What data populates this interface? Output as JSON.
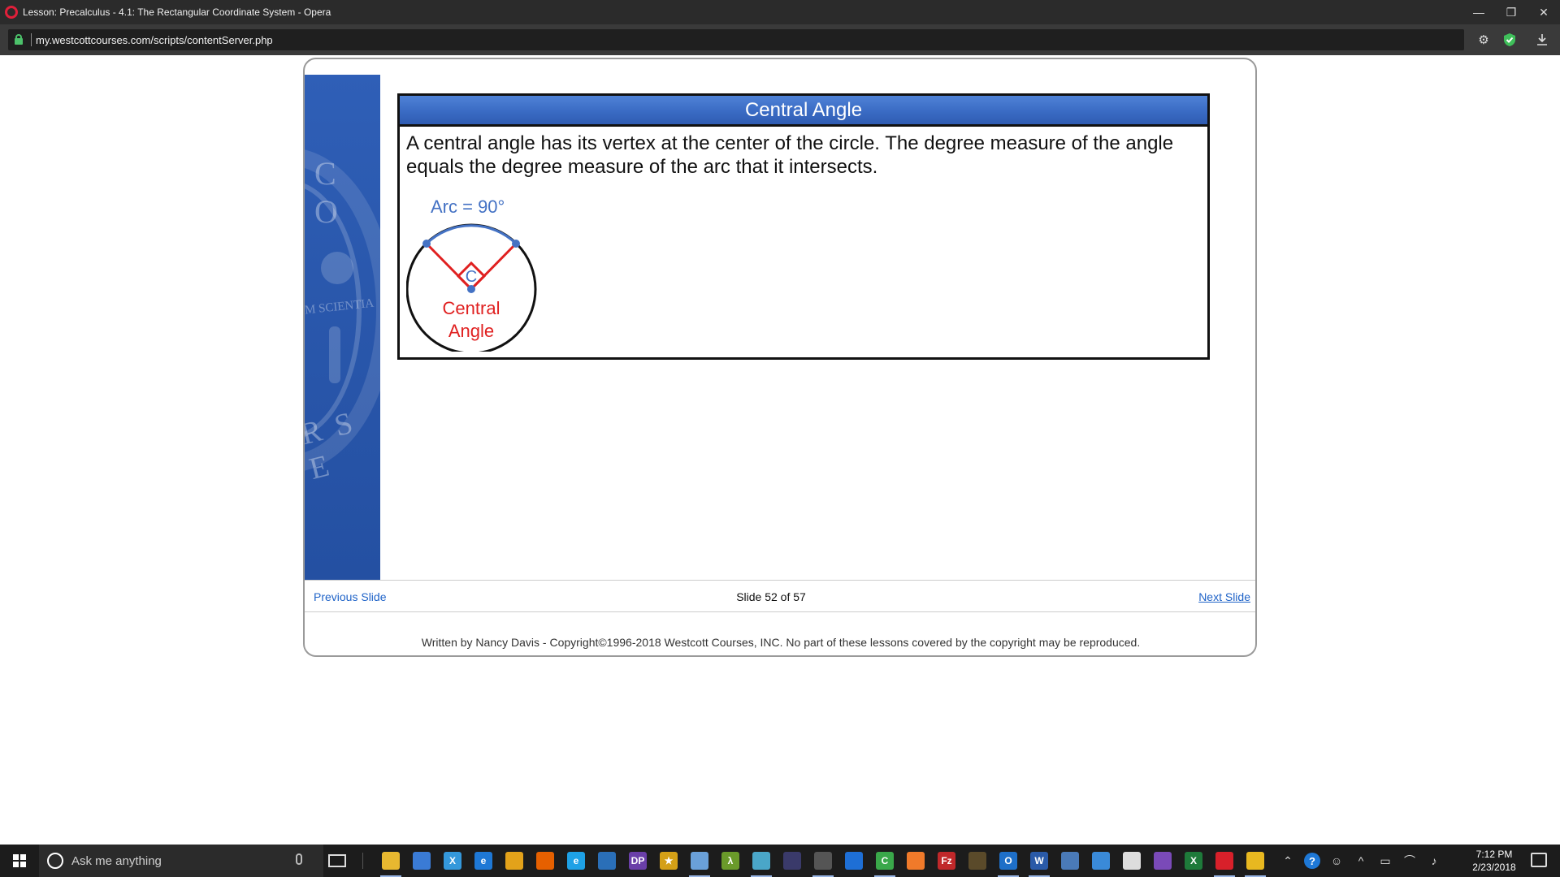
{
  "window": {
    "title": "Lesson: Precalculus - 4.1: The Rectangular Coordinate System - Opera",
    "minimize_icon": "minimize-icon",
    "restore_icon": "restore-icon",
    "close_icon": "close-icon"
  },
  "address_bar": {
    "url": "my.westcottcourses.com/scripts/contentServer.php",
    "icons": [
      "lock-icon",
      "gear-icon",
      "shield-icon",
      "download-icon"
    ]
  },
  "slide": {
    "title": "Central Angle",
    "body": "A central angle has its vertex at the center of the circle.  The degree measure of the angle equals the degree measure of the arc that it intersects.",
    "figure": {
      "arc_label": "Arc = 90°",
      "center_label": "C",
      "angle_label_line1": "Central",
      "angle_label_line2": "Angle",
      "colors": {
        "arc": "#4472c4",
        "angle": "#e02020",
        "circle": "#111111"
      }
    },
    "seal_text": {
      "top": "C O",
      "middle": "M SCIENTIA",
      "bottom": "R S E"
    }
  },
  "nav": {
    "prev_label": "Previous Slide",
    "counter": "Slide 52 of 57",
    "next_label": "Next Slide"
  },
  "footer": {
    "copyright": "Written by Nancy Davis - Copyright©1996-2018 Westcott Courses, INC. No part of these lessons covered by the copyright may be reproduced."
  },
  "taskbar": {
    "search_placeholder": "Ask me anything",
    "time": "7:12 PM",
    "date": "2/23/2018",
    "apps": [
      {
        "name": "file-explorer-icon",
        "color": "#e8b830",
        "glyph": ""
      },
      {
        "name": "store-icon",
        "color": "#3a7bd5",
        "glyph": ""
      },
      {
        "name": "xamarin-icon",
        "color": "#3498db",
        "glyph": "X"
      },
      {
        "name": "edge-icon",
        "color": "#1e78d6",
        "glyph": "e"
      },
      {
        "name": "chrome-icon",
        "color": "#e3a21a",
        "glyph": ""
      },
      {
        "name": "firefox-icon",
        "color": "#e66000",
        "glyph": ""
      },
      {
        "name": "ie-icon",
        "color": "#1ea1e6",
        "glyph": "e"
      },
      {
        "name": "powershell-icon",
        "color": "#2a6fb8",
        "glyph": ""
      },
      {
        "name": "dp-icon",
        "color": "#6a3fa8",
        "glyph": "DP"
      },
      {
        "name": "star-app-icon",
        "color": "#d4a017",
        "glyph": "★"
      },
      {
        "name": "paint-icon",
        "color": "#6aa0d8",
        "glyph": ""
      },
      {
        "name": "lambda-icon",
        "color": "#6a9a2a",
        "glyph": "λ"
      },
      {
        "name": "book-icon",
        "color": "#4aa6c8",
        "glyph": ""
      },
      {
        "name": "indie-app-icon",
        "color": "#3a3a6a",
        "glyph": ""
      },
      {
        "name": "calculator-icon",
        "color": "#555555",
        "glyph": ""
      },
      {
        "name": "teamviewer-icon",
        "color": "#1e6fd6",
        "glyph": ""
      },
      {
        "name": "camtasia-icon",
        "color": "#3aa84a",
        "glyph": "C"
      },
      {
        "name": "xampp-icon",
        "color": "#f07a2a",
        "glyph": ""
      },
      {
        "name": "filezilla-icon",
        "color": "#c0282a",
        "glyph": "Fz"
      },
      {
        "name": "sublime-icon",
        "color": "#5a4a2a",
        "glyph": ""
      },
      {
        "name": "outlook-icon",
        "color": "#1e6fc8",
        "glyph": "O"
      },
      {
        "name": "word-icon",
        "color": "#2a5aa8",
        "glyph": "W"
      },
      {
        "name": "network-app-icon",
        "color": "#4a7ab8",
        "glyph": ""
      },
      {
        "name": "remote-desktop-icon",
        "color": "#3a8ad8",
        "glyph": ""
      },
      {
        "name": "mail-icon",
        "color": "#dddddd",
        "glyph": ""
      },
      {
        "name": "visual-studio-icon",
        "color": "#7a4ab8",
        "glyph": ""
      },
      {
        "name": "excel-icon",
        "color": "#1e7a3a",
        "glyph": "X"
      },
      {
        "name": "opera-icon",
        "color": "#d8202a",
        "glyph": ""
      },
      {
        "name": "slides-app-icon",
        "color": "#e8b820",
        "glyph": ""
      }
    ],
    "tray_icons": [
      "chevron-up-icon",
      "help-icon",
      "people-icon",
      "tray-expand-icon",
      "battery-icon",
      "wifi-icon",
      "volume-icon"
    ]
  }
}
